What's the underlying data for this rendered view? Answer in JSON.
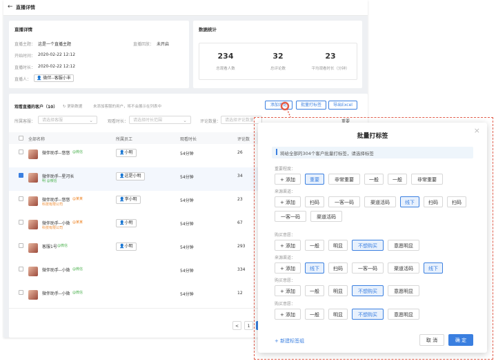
{
  "header": {
    "title": "直播详情"
  },
  "live_detail": {
    "title": "直播详情",
    "fields": [
      {
        "label": "直播主题：",
        "value": "这是一个直播主题"
      },
      {
        "label": "开始时间：",
        "value": "2020-02-22 12:12"
      },
      {
        "label": "直播时长：",
        "value": "2020-02-22 12:12"
      },
      {
        "label": "直播人：",
        "value": "微伴--客服小丰"
      }
    ],
    "replay_label": "直播回放：",
    "replay_value": "未开启"
  },
  "stats": {
    "title": "数据统计",
    "items": [
      {
        "value": "234",
        "label": "总观看人数"
      },
      {
        "value": "32",
        "label": "总评论数"
      },
      {
        "value": "23",
        "label": "平均观看时长（分钟）"
      }
    ]
  },
  "customers": {
    "title": "观看直播的客户（10）",
    "refresh": "更新数据",
    "hint": "未添加客服的用户，将不会展示在列表中",
    "buttons": {
      "add_tag": "添加评论",
      "bulk_tag": "批量打标签",
      "export": "导出Excel"
    },
    "filters": {
      "staff_label": "所属客服：",
      "staff_ph": "请选择客服",
      "duration_label": "观看时长：",
      "duration_ph": "请选择时长范围",
      "comments_label": "评论数量：",
      "comments_ph": "请选择评论数量"
    },
    "columns": [
      "全部名称",
      "所属员工",
      "观看时长",
      "评论数"
    ],
    "rows": [
      {
        "name": "微伴助手--悠悠",
        "tag": "@微信",
        "tag_color": "green",
        "sub": "",
        "staff": "小明",
        "duration": "54分钟",
        "comments": "26",
        "checked": false
      },
      {
        "name": "微伴助手--星河长",
        "tag": "",
        "tag_color": "",
        "sub": "明 @微信",
        "staff": "这是小明",
        "duration": "54分钟",
        "comments": "34",
        "checked": true
      },
      {
        "name": "微伴助手--悠悠",
        "tag": "@某某",
        "tag_color": "orange",
        "sub": "科技有限公司",
        "staff": "李小明",
        "duration": "54分钟",
        "comments": "23",
        "checked": false
      },
      {
        "name": "微伴助手--小微",
        "tag": "@某某",
        "tag_color": "orange",
        "sub": "科技有限公司",
        "staff": "小明",
        "duration": "54分钟",
        "comments": "67",
        "checked": false
      },
      {
        "name": "客服1号",
        "tag": "@微信",
        "tag_color": "green",
        "sub": "",
        "staff": "小明",
        "duration": "54分钟",
        "comments": "293",
        "checked": false
      },
      {
        "name": "微伴助手--小微",
        "tag": "@微信",
        "tag_color": "green",
        "sub": "",
        "staff": "",
        "duration": "54分钟",
        "comments": "334",
        "checked": false
      },
      {
        "name": "微伴助手--小微",
        "tag": "@微信",
        "tag_color": "green",
        "sub": "",
        "staff": "",
        "duration": "54分钟",
        "comments": "12",
        "checked": false
      }
    ],
    "pager": {
      "prev": "<",
      "page1": "1"
    }
  },
  "modal": {
    "title": "批量打标签",
    "info": "将给全部的304个客户批量打标签，请选择标签",
    "add_label": "+ 添加",
    "groups": [
      {
        "title": "重要程度：",
        "tags": [
          {
            "t": "重要",
            "s": true
          },
          {
            "t": "非常重要",
            "s": false
          },
          {
            "t": "一般",
            "s": false
          },
          {
            "t": "一般",
            "s": false
          },
          {
            "t": "非常重要",
            "s": false
          }
        ]
      },
      {
        "title": "来源渠道：",
        "tags": [
          {
            "t": "扫码",
            "s": false
          },
          {
            "t": "一客一码",
            "s": false
          },
          {
            "t": "渠道活码",
            "s": false
          },
          {
            "t": "线下",
            "s": true
          },
          {
            "t": "扫码",
            "s": false
          },
          {
            "t": "扫码",
            "s": false
          },
          {
            "t": "一客一码",
            "s": false
          },
          {
            "t": "渠道活码",
            "s": false
          }
        ]
      },
      {
        "title": "购买意愿：",
        "tags": [
          {
            "t": "一般",
            "s": false
          },
          {
            "t": "明显",
            "s": false
          },
          {
            "t": "不想购买",
            "s": true
          },
          {
            "t": "意愿明显",
            "s": false
          }
        ]
      },
      {
        "title": "来源渠道：",
        "tags": [
          {
            "t": "线下",
            "s": true
          },
          {
            "t": "扫码",
            "s": false
          },
          {
            "t": "一客一码",
            "s": false
          },
          {
            "t": "渠道活码",
            "s": false
          },
          {
            "t": "线下",
            "s": true
          }
        ]
      },
      {
        "title": "购买意愿：",
        "tags": [
          {
            "t": "一般",
            "s": false
          },
          {
            "t": "明显",
            "s": false
          },
          {
            "t": "不想购买",
            "s": true
          },
          {
            "t": "意愿明显",
            "s": false
          }
        ]
      },
      {
        "title": "购买意愿：",
        "tags": [
          {
            "t": "一般",
            "s": false
          },
          {
            "t": "明显",
            "s": false
          },
          {
            "t": "不想购买",
            "s": true
          },
          {
            "t": "意愿明显",
            "s": false
          }
        ]
      }
    ],
    "new_group": "+ 新建标签组",
    "cancel": "取 消",
    "ok": "确 定",
    "close": "×"
  },
  "behind_text": "重要"
}
